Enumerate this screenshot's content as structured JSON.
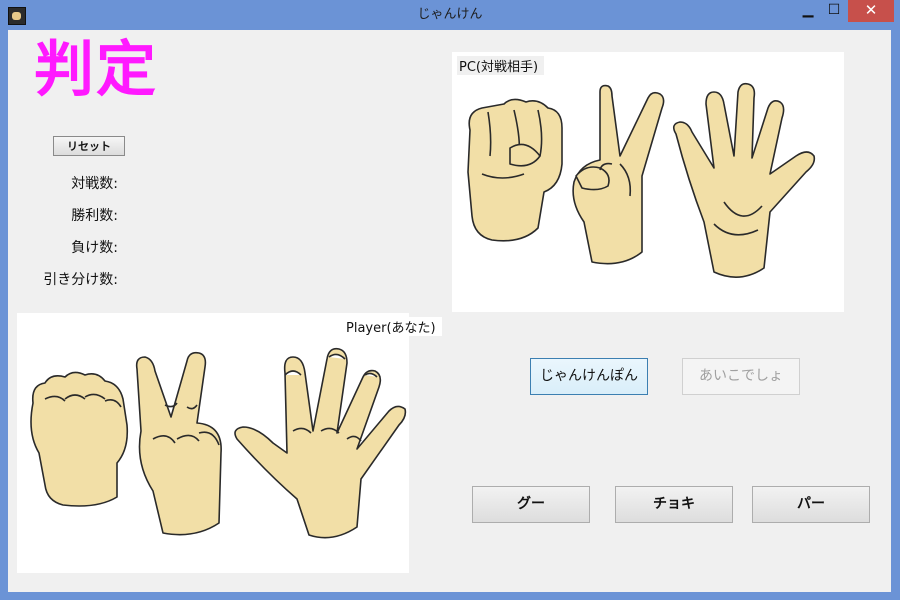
{
  "window": {
    "title": "じゃんけん",
    "minimize_glyph": "▁",
    "maximize_glyph": "☐",
    "close_glyph": "✕"
  },
  "judge": {
    "text": "判定",
    "color": "#ff19ff"
  },
  "reset": {
    "label": "リセット"
  },
  "stats": {
    "matches_label": "対戦数:",
    "wins_label": "勝利数:",
    "losses_label": "負け数:",
    "draws_label": "引き分け数:"
  },
  "pc_panel": {
    "label": "PC(対戦相手)"
  },
  "player_panel": {
    "label": "Player(あなた)"
  },
  "actions": {
    "janken_label": "じゃんけんぽん",
    "aiko_label": "あいこでしょ"
  },
  "choices": {
    "gu_label": "グー",
    "choki_label": "チョキ",
    "pa_label": "パー"
  },
  "colors": {
    "skin": "#f2dfa7",
    "outline": "#2a2a2a",
    "title_bar": "#6b93d6",
    "close": "#c7504b"
  },
  "icons": [
    "app-icon",
    "rock-hand-icon",
    "scissors-hand-icon",
    "paper-hand-icon"
  ]
}
